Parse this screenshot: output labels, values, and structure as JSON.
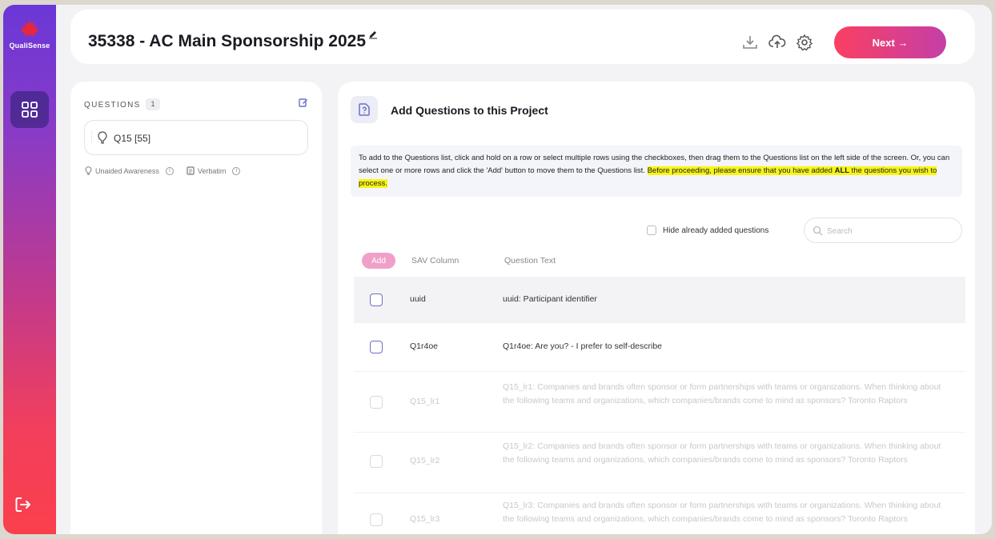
{
  "app": {
    "name": "QualiSense"
  },
  "header": {
    "project_title": "35338 - AC Main Sponsorship 2025",
    "next_label": "Next →",
    "icons": [
      "download-icon",
      "upload-cloud-icon",
      "settings-icon"
    ]
  },
  "sidebar": {
    "items": [
      {
        "name": "dashboard",
        "icon": "grid-icon"
      },
      {
        "name": "logout",
        "icon": "logout-icon"
      }
    ]
  },
  "questions_panel": {
    "label": "QUESTIONS",
    "count": "1",
    "items": [
      {
        "label": "Q15 [55]",
        "tags": [
          "Unaided Awareness",
          "Verbatim"
        ]
      }
    ]
  },
  "main": {
    "title": "Add Questions to this Project",
    "instructions": {
      "text": "To add to the Questions list, click and hold on a row or select multiple rows using the checkboxes, then drag them to the Questions list on the left side of the screen. Or, you can select one or more rows and click the 'Add' button to move them to the Questions list.",
      "highlight_pre": "Before proceeding, please ensure that you have added ",
      "highlight_bold": "ALL",
      "highlight_post": " the questions you wish to process."
    },
    "hide_added_label": "Hide already added questions",
    "search_placeholder": "Search",
    "table": {
      "add_label": "Add",
      "columns": [
        "SAV Column",
        "Question Text"
      ],
      "rows": [
        {
          "col": "uuid",
          "text": "uuid: Participant identifier",
          "state": "active"
        },
        {
          "col": "Q1r4oe",
          "text": "Q1r4oe: Are you? - I prefer to self-describe",
          "state": "enabled"
        },
        {
          "col": "Q15_lr1",
          "text": "Q15_lr1: Companies and brands often sponsor or form partnerships with teams or organizations. When thinking about the following teams and organizations, which companies/brands come to mind as sponsors? Toronto Raptors",
          "state": "disabled"
        },
        {
          "col": "Q15_lr2",
          "text": "Q15_lr2: Companies and brands often sponsor or form partnerships with teams or organizations. When thinking about the following teams and organizations, which companies/brands come to mind as sponsors? Toronto Raptors",
          "state": "disabled"
        },
        {
          "col": "Q15_lr3",
          "text": "Q15_lr3: Companies and brands often sponsor or form partnerships with teams or organizations. When thinking about the following teams and organizations, which companies/brands come to mind as sponsors? Toronto Raptors",
          "state": "disabled"
        }
      ]
    }
  },
  "colors": {
    "accent": "#6b6fc9",
    "next_gradient_start": "#fb3f62",
    "next_gradient_end": "#c43fa8",
    "highlight": "#f8f516"
  }
}
